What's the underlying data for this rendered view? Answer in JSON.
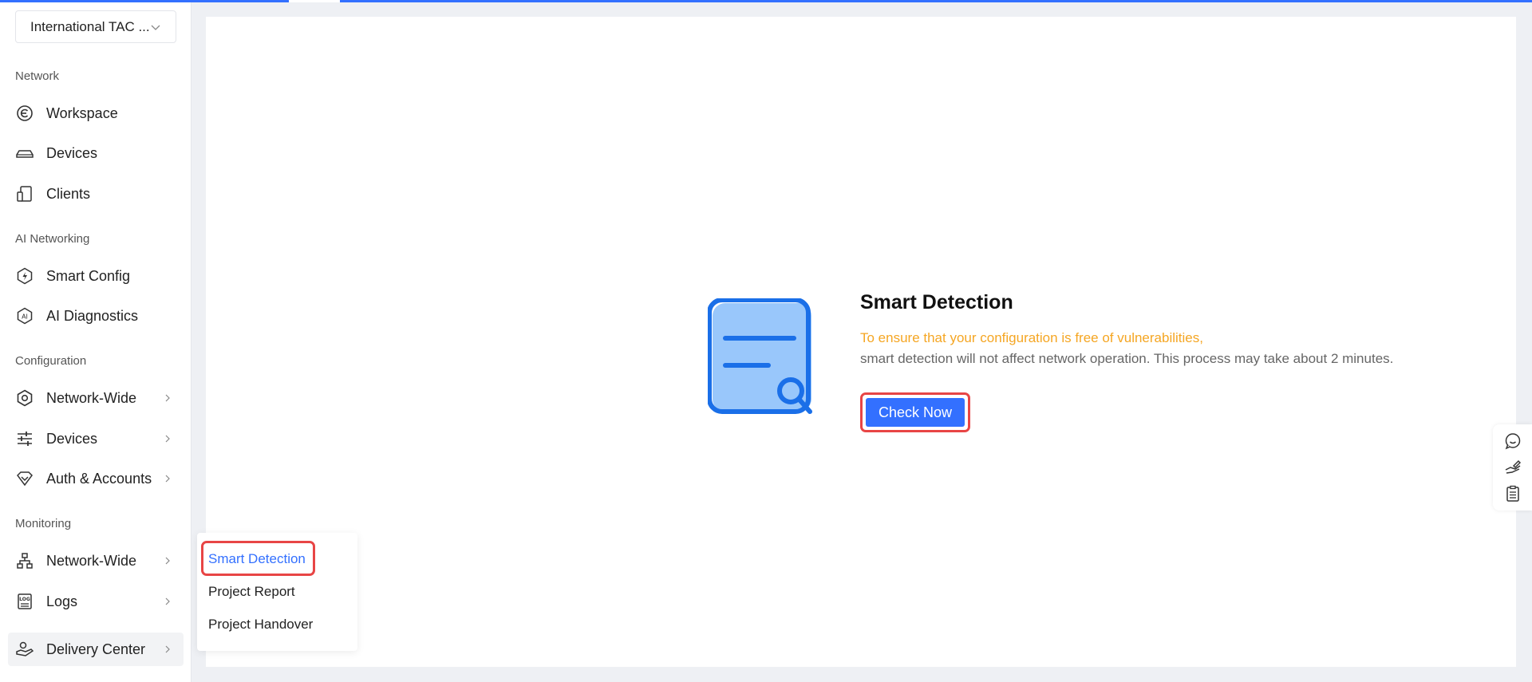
{
  "org_selector": {
    "value": "International TAC ..."
  },
  "sidebar": {
    "sections": [
      {
        "title": "Network"
      },
      {
        "title": "AI Networking"
      },
      {
        "title": "Configuration"
      },
      {
        "title": "Monitoring"
      }
    ],
    "items": [
      {
        "label": "Workspace",
        "icon": "workspace-icon"
      },
      {
        "label": "Devices",
        "icon": "devices-icon"
      },
      {
        "label": "Clients",
        "icon": "clients-icon"
      },
      {
        "label": "Smart Config",
        "icon": "smart-config-icon"
      },
      {
        "label": "AI Diagnostics",
        "icon": "ai-diagnostics-icon"
      },
      {
        "label": "Network-Wide",
        "icon": "gear-icon",
        "has_submenu": true
      },
      {
        "label": "Devices",
        "icon": "sliders-icon",
        "has_submenu": true
      },
      {
        "label": "Auth & Accounts",
        "icon": "shield-icon",
        "has_submenu": true
      },
      {
        "label": "Network-Wide",
        "icon": "topology-icon",
        "has_submenu": true
      },
      {
        "label": "Logs",
        "icon": "logs-icon",
        "has_submenu": true
      },
      {
        "label": "Delivery Center",
        "icon": "delivery-icon",
        "has_submenu": true,
        "active": true
      }
    ]
  },
  "main": {
    "title": "Smart Detection",
    "warning": "To ensure that your configuration is free of vulnerabilities,",
    "description": "smart detection will not affect network operation. This process may take about 2 minutes.",
    "check_button": "Check Now"
  },
  "popup_menu": {
    "items": [
      {
        "label": "Smart Detection",
        "selected": true
      },
      {
        "label": "Project Report"
      },
      {
        "label": "Project Handover"
      }
    ]
  },
  "floating_tools": [
    "chat-icon",
    "feedback-icon",
    "clipboard-icon"
  ],
  "colors": {
    "accent": "#3370ff",
    "warning": "#f5a623",
    "highlight": "#e84545"
  }
}
